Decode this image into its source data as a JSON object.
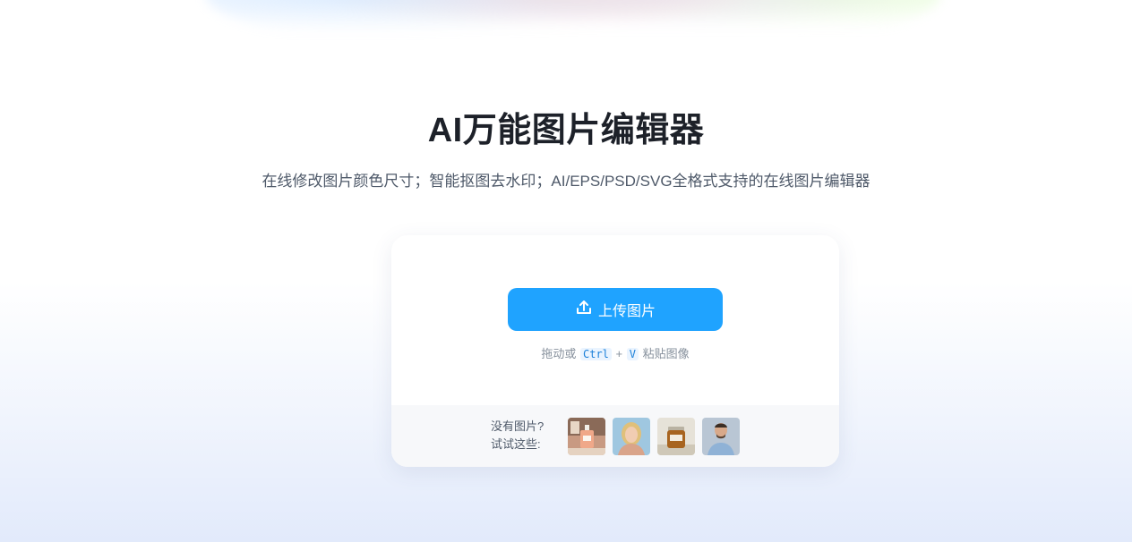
{
  "hero": {
    "title": "AI万能图片编辑器",
    "subtitle": "在线修改图片颜色尺寸；智能抠图去水印；AI/EPS/PSD/SVG全格式支持的在线图片编辑器"
  },
  "upload": {
    "button_label": "上传图片",
    "button_icon": "upload-icon",
    "hint_prefix": "拖动或",
    "key_ctrl": "Ctrl",
    "key_plus": "+",
    "key_v": "V",
    "hint_suffix": "粘贴图像"
  },
  "samples": {
    "label_line1": "没有图片?",
    "label_line2": "试试这些:",
    "items": [
      {
        "name": "perfume-bottle-sample"
      },
      {
        "name": "woman-portrait-sample"
      },
      {
        "name": "candle-jar-sample"
      },
      {
        "name": "man-portrait-sample"
      }
    ]
  },
  "colors": {
    "accent": "#1fa3ff",
    "title": "#1d2129",
    "subtitle": "#4e5969",
    "hint": "#86909c"
  }
}
